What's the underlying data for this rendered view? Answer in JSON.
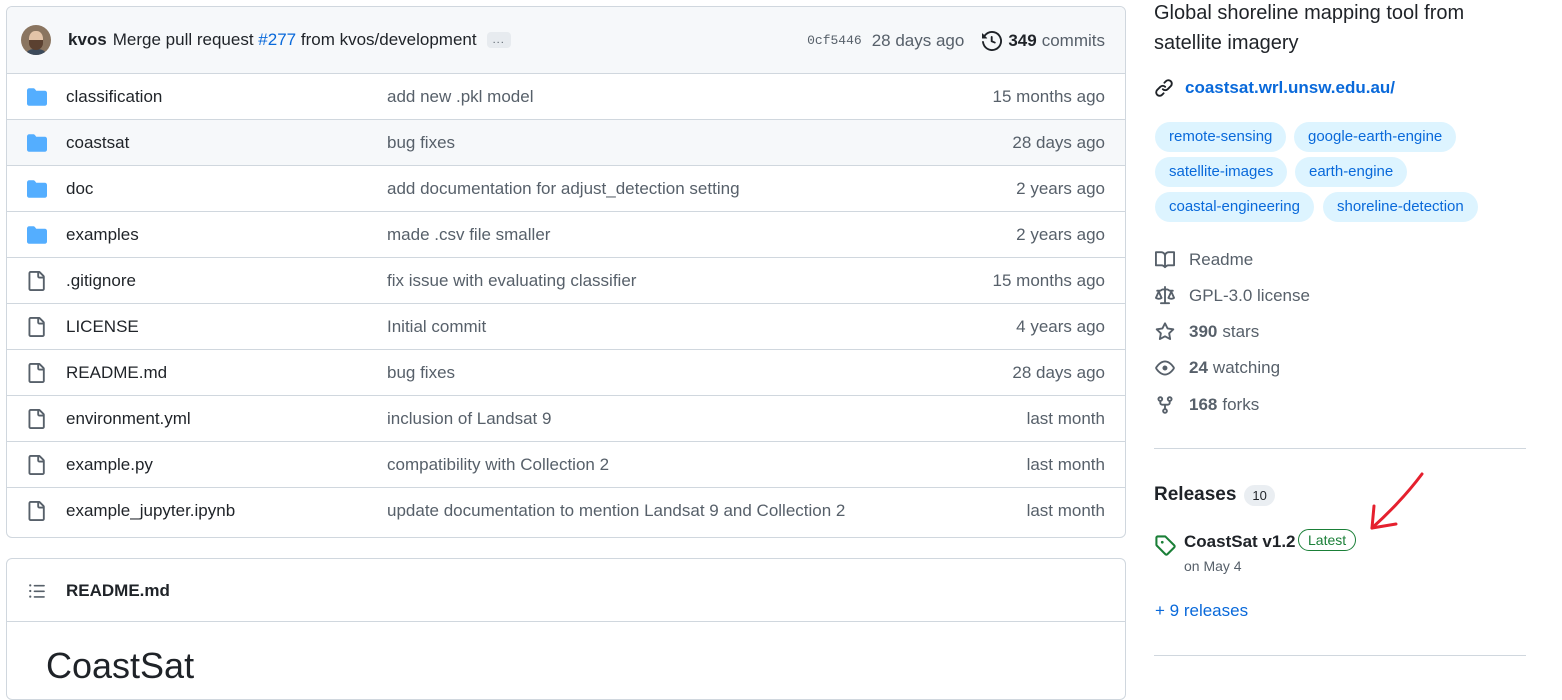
{
  "latest_commit": {
    "author": "kvos",
    "message_prefix": "Merge pull request",
    "pr_number": "#277",
    "message_suffix": "from kvos/development",
    "ellipsis": "...",
    "sha": "0cf5446",
    "time_ago": "28 days ago",
    "commit_count": "349",
    "commits_label": "commits"
  },
  "files": [
    {
      "type": "folder",
      "name": "classification",
      "message": "add new .pkl model",
      "date": "15 months ago"
    },
    {
      "type": "folder",
      "name": "coastsat",
      "message": "bug fixes",
      "date": "28 days ago"
    },
    {
      "type": "folder",
      "name": "doc",
      "message": "add documentation for adjust_detection setting",
      "date": "2 years ago"
    },
    {
      "type": "folder",
      "name": "examples",
      "message": "made .csv file smaller",
      "date": "2 years ago"
    },
    {
      "type": "file",
      "name": ".gitignore",
      "message": "fix issue with evaluating classifier",
      "date": "15 months ago"
    },
    {
      "type": "file",
      "name": "LICENSE",
      "message": "Initial commit",
      "date": "4 years ago"
    },
    {
      "type": "file",
      "name": "README.md",
      "message": "bug fixes",
      "date": "28 days ago"
    },
    {
      "type": "file",
      "name": "environment.yml",
      "message": "inclusion of Landsat 9",
      "date": "last month"
    },
    {
      "type": "file",
      "name": "example.py",
      "message": "compatibility with Collection 2",
      "date": "last month"
    },
    {
      "type": "file",
      "name": "example_jupyter.ipynb",
      "message": "update documentation to mention Landsat 9 and Collection 2",
      "date": "last month"
    }
  ],
  "readme": {
    "file_title": "README.md",
    "heading": "CoastSat"
  },
  "about": {
    "description": "Global shoreline mapping tool from satellite imagery",
    "website": "coastsat.wrl.unsw.edu.au/",
    "topics": [
      "remote-sensing",
      "google-earth-engine",
      "satellite-images",
      "earth-engine",
      "coastal-engineering",
      "shoreline-detection"
    ],
    "readme_label": "Readme",
    "license_label": "GPL-3.0 license",
    "stars_count": "390",
    "stars_label": "stars",
    "watching_count": "24",
    "watching_label": "watching",
    "forks_count": "168",
    "forks_label": "forks"
  },
  "releases": {
    "title": "Releases",
    "count": "10",
    "latest_name": "CoastSat v1.2",
    "latest_badge": "Latest",
    "latest_date": "on May 4",
    "more_link": "+ 9 releases"
  },
  "colors": {
    "link": "#0969da",
    "folder_icon": "#54aeff",
    "latest_green": "#1a7f37",
    "annotation_arrow": "#e5202e"
  }
}
